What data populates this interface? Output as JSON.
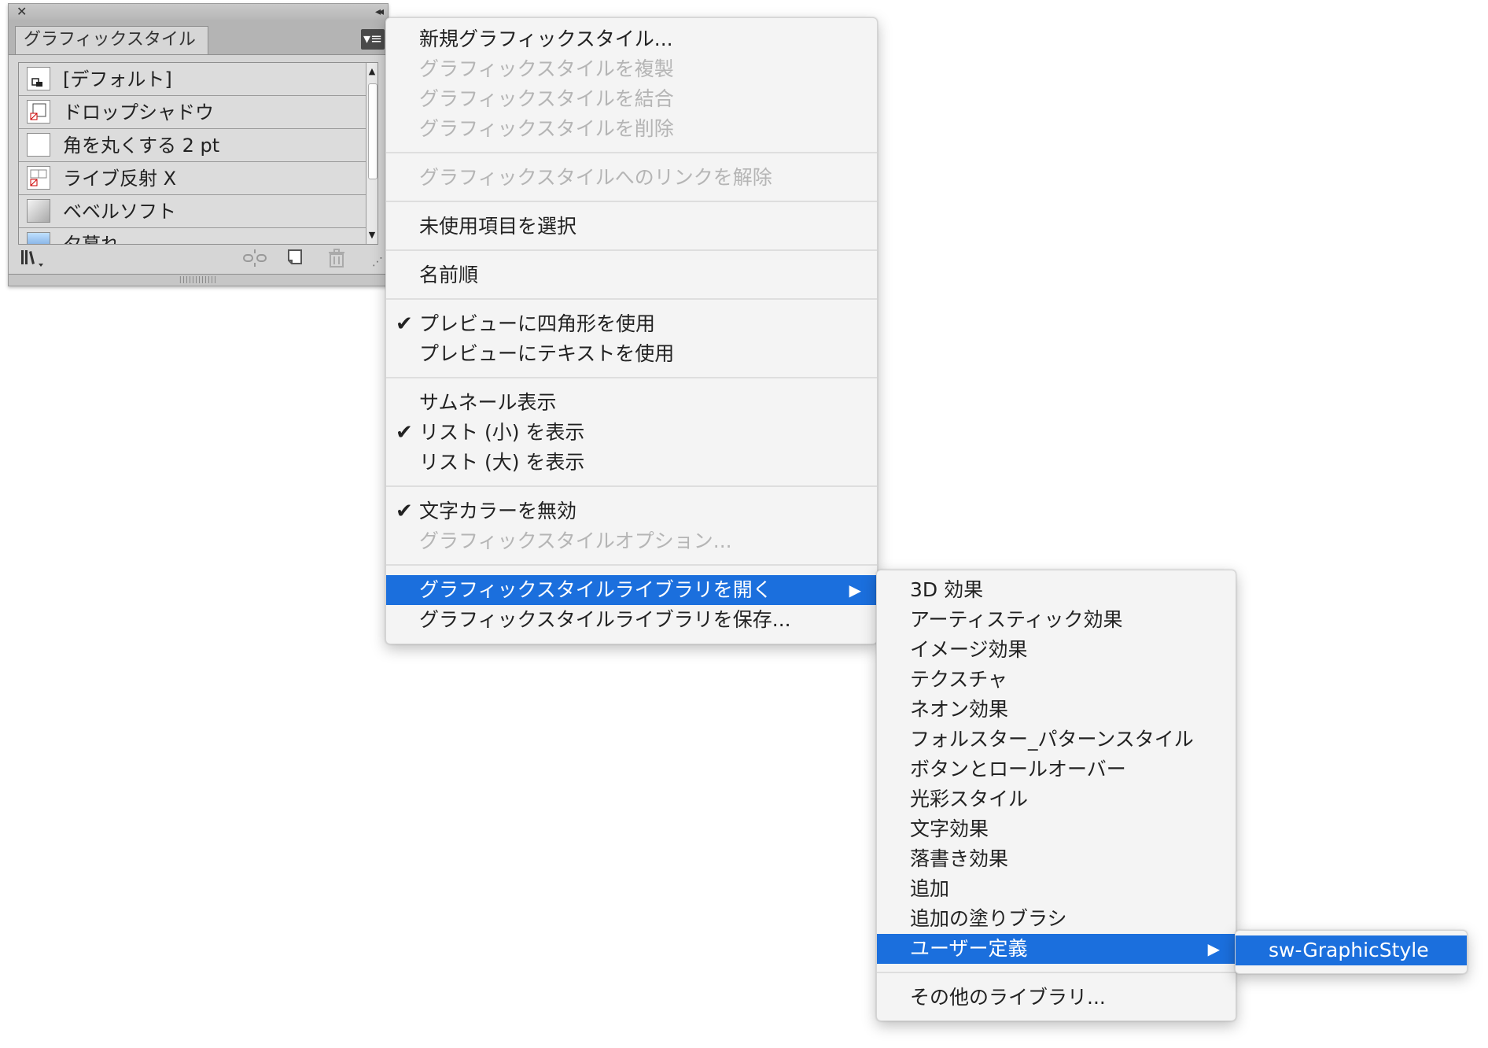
{
  "panel": {
    "tab_title": "グラフィックスタイル",
    "close_glyph": "✕",
    "collapse_glyph": "◂◂",
    "menu_glyph": "▾≡",
    "gripper_glyph": "||||||||||||",
    "styles": [
      "[デフォルト]",
      "ドロップシャドウ",
      "角を丸くする 2 pt",
      "ライブ反射 X",
      "ベベルソフト",
      "夕暮れ"
    ],
    "bottom_icons": [
      "libraries-menu-icon",
      "break-link-icon",
      "new-style-icon",
      "trash-icon"
    ]
  },
  "main_menu": {
    "items": [
      {
        "label": "新規グラフィックスタイル...",
        "enabled": true
      },
      {
        "label": "グラフィックスタイルを複製",
        "enabled": false
      },
      {
        "label": "グラフィックスタイルを結合",
        "enabled": false
      },
      {
        "label": "グラフィックスタイルを削除",
        "enabled": false
      },
      {
        "label": "グラフィックスタイルへのリンクを解除",
        "enabled": false
      },
      {
        "label": "未使用項目を選択",
        "enabled": true
      },
      {
        "label": "名前順",
        "enabled": true
      },
      {
        "label": "プレビューに四角形を使用",
        "enabled": true,
        "checked": true
      },
      {
        "label": "プレビューにテキストを使用",
        "enabled": true
      },
      {
        "label": "サムネール表示",
        "enabled": true
      },
      {
        "label": "リスト (小) を表示",
        "enabled": true,
        "checked": true
      },
      {
        "label": "リスト (大) を表示",
        "enabled": true
      },
      {
        "label": "文字カラーを無効",
        "enabled": true,
        "checked": true
      },
      {
        "label": "グラフィックスタイルオプション...",
        "enabled": false
      },
      {
        "label": "グラフィックスタイルライブラリを開く",
        "enabled": true,
        "highlighted": true,
        "submenu": true
      },
      {
        "label": "グラフィックスタイルライブラリを保存...",
        "enabled": true
      }
    ],
    "check_glyph": "✔",
    "arrow_glyph": "▶"
  },
  "library_submenu": {
    "items": [
      {
        "label": "3D 効果"
      },
      {
        "label": "アーティスティック効果"
      },
      {
        "label": "イメージ効果"
      },
      {
        "label": "テクスチャ"
      },
      {
        "label": "ネオン効果"
      },
      {
        "label": "フォルスター_パターンスタイル"
      },
      {
        "label": "ボタンとロールオーバー"
      },
      {
        "label": "光彩スタイル"
      },
      {
        "label": "文字効果"
      },
      {
        "label": "落書き効果"
      },
      {
        "label": "追加"
      },
      {
        "label": "追加の塗りブラシ"
      },
      {
        "label": "ユーザー定義",
        "highlighted": true,
        "submenu": true
      },
      {
        "label": "その他のライブラリ..."
      }
    ]
  },
  "user_submenu": {
    "items": [
      {
        "label": "sw-GraphicStyle",
        "highlighted": true
      }
    ]
  },
  "colors": {
    "highlight": "#1b6fdd",
    "disabled_text": "#b5b5b5",
    "menu_bg": "#f4f4f4",
    "panel_bg": "#d6d6d6"
  }
}
